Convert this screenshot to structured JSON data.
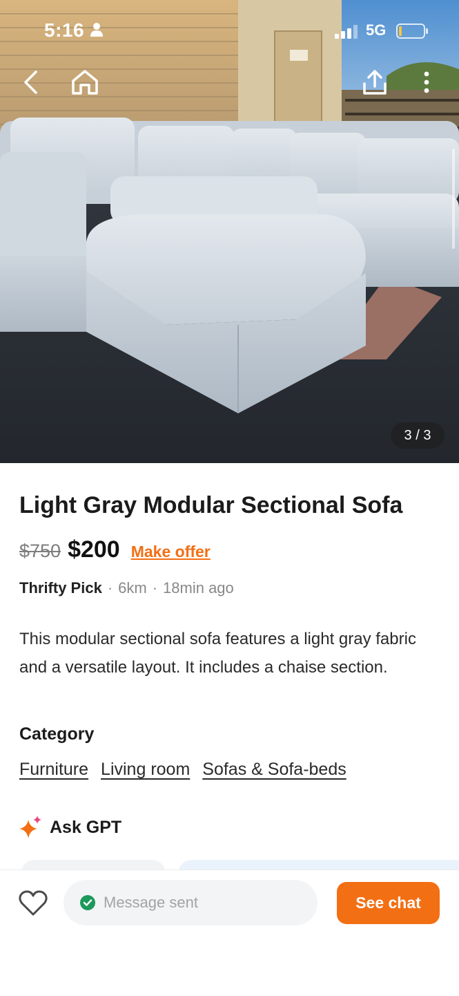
{
  "status_bar": {
    "time": "5:16",
    "network": "5G"
  },
  "hero": {
    "image_counter": "3 / 3"
  },
  "listing": {
    "title": "Light Gray Modular Sectional Sofa",
    "original_price": "$750",
    "price": "$200",
    "offer_label": "Make offer",
    "seller": "Thrifty Pick",
    "distance": "6km",
    "posted": "18min ago",
    "separator": "·",
    "description": "This modular sectional sofa features a light gray fabric and a versatile layout. It includes a chaise section."
  },
  "category": {
    "heading": "Category",
    "items": [
      "Furniture",
      "Living room",
      "Sofas & Sofa-beds"
    ]
  },
  "ask_gpt": {
    "label": "Ask GPT"
  },
  "bottom_bar": {
    "message_status": "Message sent",
    "chat_button": "See chat"
  },
  "colors": {
    "accent": "#f36f14",
    "success": "#1d9a5b",
    "text": "#1b1b1b",
    "muted": "#888888"
  },
  "icons": [
    "person-icon",
    "signal-icon",
    "battery-icon",
    "back-icon",
    "home-icon",
    "share-icon",
    "more-icon",
    "sparkle-icon",
    "heart-icon",
    "check-icon"
  ]
}
